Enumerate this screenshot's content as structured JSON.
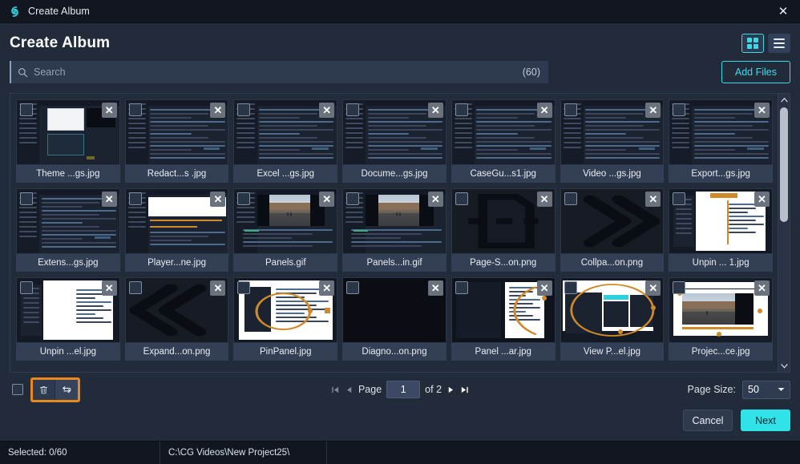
{
  "titlebar": {
    "title": "Create Album",
    "logo_icon": "spiral-logo-icon",
    "close_icon": "✕",
    "accent": "#3fd9e6"
  },
  "header": {
    "title": "Create Album",
    "grid_view_icon": "grid-view-icon",
    "list_view_icon": "list-view-icon",
    "active_view": "grid"
  },
  "search": {
    "placeholder": "Search",
    "value": "",
    "icon": "search-icon",
    "count": "(60)"
  },
  "toolbar": {
    "add_files_label": "Add Files"
  },
  "files": [
    {
      "name": "Theme ...gs.jpg",
      "art": "app-white"
    },
    {
      "name": "Redact...s .jpg",
      "art": "app-code"
    },
    {
      "name": "Excel ...gs.jpg",
      "art": "app-code"
    },
    {
      "name": "Docume...gs.jpg",
      "art": "app-code"
    },
    {
      "name": "CaseGu...s1.jpg",
      "art": "app-code"
    },
    {
      "name": "Video ...gs.jpg",
      "art": "app-code"
    },
    {
      "name": "Export...gs.jpg",
      "art": "app-code"
    },
    {
      "name": "Extens...gs.jpg",
      "art": "app-code"
    },
    {
      "name": "Player...ne.jpg",
      "art": "app-timeline"
    },
    {
      "name": "Panels.gif",
      "art": "road-editor"
    },
    {
      "name": "Panels...in.gif",
      "art": "road-editor"
    },
    {
      "name": "Page-S...on.png",
      "art": "icon-page-split"
    },
    {
      "name": "Collpa...on.png",
      "art": "icon-chev-right"
    },
    {
      "name": "Unpin ... 1.jpg",
      "art": "app-panel-orange"
    },
    {
      "name": "Unpin ...el.jpg",
      "art": "app-panel-white"
    },
    {
      "name": "Expand...on.png",
      "art": "icon-chev-left"
    },
    {
      "name": "PinPanel.jpg",
      "art": "app-menu-white"
    },
    {
      "name": "Diagno...on.png",
      "art": "icon-blank"
    },
    {
      "name": "Panel ...ar.jpg",
      "art": "app-panel-arc"
    },
    {
      "name": "View P...el.jpg",
      "art": "app-menu-arc"
    },
    {
      "name": "Projec...ce.jpg",
      "art": "road-framed"
    }
  ],
  "card": {
    "close_icon": "✕",
    "checkbox_icon": "checkbox-icon"
  },
  "scrollbar": {
    "up_icon": "chevron-up-icon",
    "down_icon": "chevron-down-icon"
  },
  "bottom": {
    "select_all_icon": "checkbox-icon",
    "delete_icon": "trash-icon",
    "refresh_icon": "replace-icon",
    "highlight_color": "#e8881f"
  },
  "pagination": {
    "first_icon": "⏮",
    "prev_icon": "◀",
    "page_label": "Page",
    "page_value": "1",
    "of_label": "of 2",
    "next_icon": "▶",
    "last_icon": "⏭",
    "page_size_label": "Page Size:",
    "page_size_value": "50",
    "page_size_chevron": "▼"
  },
  "actions": {
    "cancel_label": "Cancel",
    "next_label": "Next",
    "next_color": "#2fe3e8"
  },
  "statusbar": {
    "selected": "Selected: 0/60",
    "path": "C:\\CG Videos\\New Project25\\"
  }
}
